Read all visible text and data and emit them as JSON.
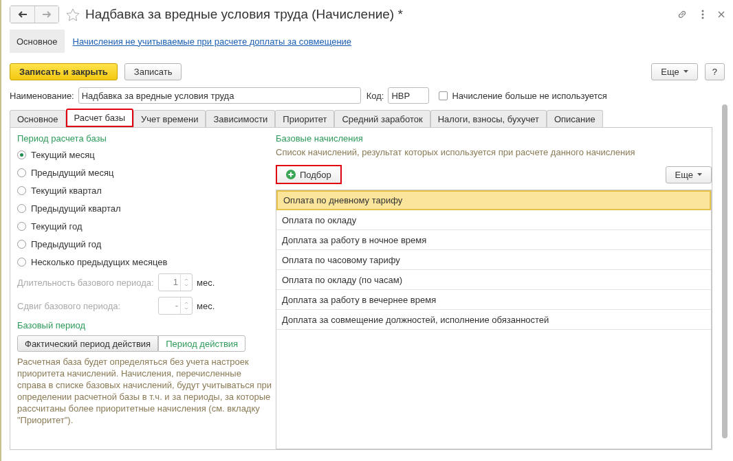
{
  "window": {
    "title": "Надбавка за вредные условия труда (Начисление) *"
  },
  "nav_tabs": [
    {
      "label": "Основное",
      "selected": true
    }
  ],
  "nav_link": "Начисления не учитываемые при расчете доплаты за совмещение",
  "toolbar": {
    "save_close": "Записать и закрыть",
    "save": "Записать",
    "more": "Еще",
    "help": "?"
  },
  "name_field": {
    "label": "Наименование:",
    "value": "Надбавка за вредные условия труда"
  },
  "code_field": {
    "label": "Код:",
    "value": "НВР"
  },
  "unused_checkbox": {
    "label": "Начисление больше не используется",
    "checked": false
  },
  "tabs": [
    {
      "label": "Основное",
      "selected": false,
      "highlighted": false
    },
    {
      "label": "Расчет базы",
      "selected": true,
      "highlighted": true
    },
    {
      "label": "Учет времени",
      "selected": false,
      "highlighted": false
    },
    {
      "label": "Зависимости",
      "selected": false,
      "highlighted": false
    },
    {
      "label": "Приоритет",
      "selected": false,
      "highlighted": false
    },
    {
      "label": "Средний заработок",
      "selected": false,
      "highlighted": false
    },
    {
      "label": "Налоги, взносы, бухучет",
      "selected": false,
      "highlighted": false
    },
    {
      "label": "Описание",
      "selected": false,
      "highlighted": false
    }
  ],
  "period": {
    "heading": "Период расчета базы",
    "options": [
      {
        "label": "Текущий месяц",
        "selected": true
      },
      {
        "label": "Предыдущий месяц",
        "selected": false
      },
      {
        "label": "Текущий квартал",
        "selected": false
      },
      {
        "label": "Предыдущий квартал",
        "selected": false
      },
      {
        "label": "Текущий год",
        "selected": false
      },
      {
        "label": "Предыдущий год",
        "selected": false
      },
      {
        "label": "Несколько предыдущих месяцев",
        "selected": false
      }
    ],
    "spinners": [
      {
        "label": "Длительность базового периода:",
        "value": "1",
        "unit": "мес.",
        "disabled": true
      },
      {
        "label": "Сдвиг базового периода:",
        "value": "-",
        "unit": "мес.",
        "disabled": true
      }
    ]
  },
  "base_period": {
    "heading": "Базовый период",
    "options": [
      {
        "label": "Фактический период действия",
        "selected": true
      },
      {
        "label": "Период действия",
        "selected": false
      }
    ],
    "note": "Расчетная база будет определяться без учета настроек приоритета начислений. Начисления, перечисленные справа в списке базовых начислений, будут учитываться при определении расчетной базы в т.ч. и за периоды, за которые рассчитаны более приоритетные начисления (см. вкладку \"Приоритет\")."
  },
  "base_accruals": {
    "heading": "Базовые начисления",
    "description": "Список начислений, результат которых используется при расчете данного начисления",
    "pick_button": {
      "label": "Подбор",
      "highlighted": true
    },
    "more": "Еще",
    "rows": [
      {
        "label": "Оплата по дневному тарифу",
        "selected": true
      },
      {
        "label": "Оплата по окладу",
        "selected": false
      },
      {
        "label": "Доплата за работу в ночное время",
        "selected": false
      },
      {
        "label": "Оплата по часовому тарифу",
        "selected": false
      },
      {
        "label": "Оплата по окладу (по часам)",
        "selected": false
      },
      {
        "label": "Доплата за работу в вечернее время",
        "selected": false
      },
      {
        "label": "Доплата за совмещение должностей, исполнение обязанностей",
        "selected": false
      }
    ]
  }
}
